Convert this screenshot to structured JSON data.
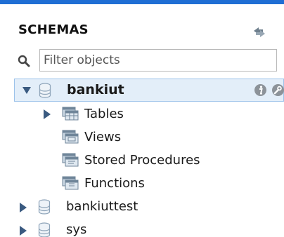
{
  "header": {
    "title": "SCHEMAS",
    "refresh_icon": "refresh-arrows-icon"
  },
  "search": {
    "placeholder": "Filter objects",
    "icon": "search-icon"
  },
  "schemas": [
    {
      "name": "bankiut",
      "expanded": true,
      "selected": true,
      "icon": "database-icon",
      "children": [
        {
          "label": "Tables",
          "expandable": true,
          "icon": "tables-folder-icon"
        },
        {
          "label": "Views",
          "expandable": false,
          "icon": "views-folder-icon"
        },
        {
          "label": "Stored Procedures",
          "expandable": false,
          "icon": "procedures-folder-icon"
        },
        {
          "label": "Functions",
          "expandable": false,
          "icon": "functions-folder-icon"
        }
      ]
    },
    {
      "name": "bankiuttest",
      "expanded": false,
      "selected": false,
      "icon": "database-icon"
    },
    {
      "name": "sys",
      "expanded": false,
      "selected": false,
      "icon": "database-icon"
    }
  ],
  "colors": {
    "accent": "#1f6ed4",
    "selection_bg": "#e3eef9",
    "selection_border": "#9cc2ea"
  }
}
